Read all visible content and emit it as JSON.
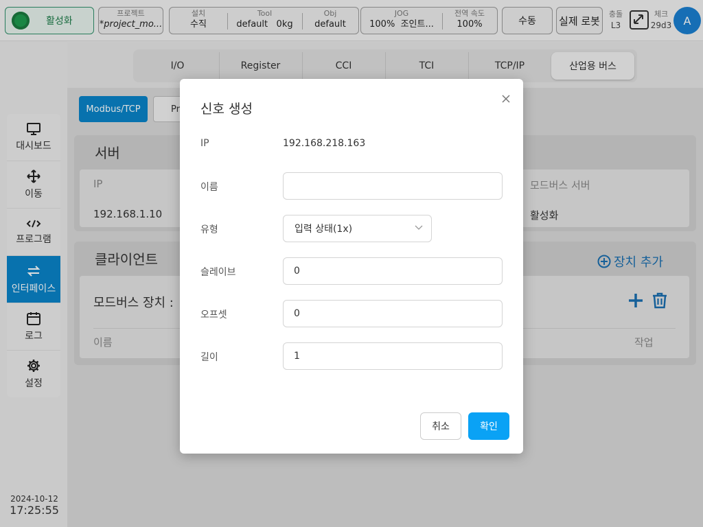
{
  "topbar": {
    "status_label": "활성화",
    "project": {
      "label": "프로젝트",
      "value": "*project_mo..."
    },
    "install": {
      "label": "설치",
      "value": "수직"
    },
    "tool": {
      "label": "Tool",
      "value": "default",
      "weight": "0kg"
    },
    "obj": {
      "label": "Obj",
      "value": "default"
    },
    "jog": {
      "label": "JOG",
      "percent": "100%",
      "mode": "조인트..."
    },
    "global_speed": {
      "label": "전역 속도",
      "value": "100%"
    },
    "mode_button": "수동",
    "robot_button": "실제 로봇",
    "collision": {
      "label": "충돌",
      "value": "L3"
    },
    "check": {
      "label": "체크",
      "value": "29d3"
    },
    "avatar_letter": "A"
  },
  "sidebar": {
    "items": [
      {
        "label": "대시보드",
        "icon": "monitor-icon"
      },
      {
        "label": "이동",
        "icon": "move-icon"
      },
      {
        "label": "프로그램",
        "icon": "code-icon"
      },
      {
        "label": "인터페이스",
        "icon": "swap-icon",
        "active": true
      },
      {
        "label": "로그",
        "icon": "calendar-icon"
      },
      {
        "label": "설정",
        "icon": "gear-icon"
      }
    ],
    "date": "2024-10-12",
    "time": "17:25:55"
  },
  "tabs": [
    "I/O",
    "Register",
    "CCI",
    "TCI",
    "TCP/IP",
    "산업용 버스"
  ],
  "protocol": {
    "active": "Modbus/TCP",
    "other": "Pr"
  },
  "server": {
    "title": "서버",
    "ip_label": "IP",
    "ip_value": "192.168.1.10",
    "modbus_label": "모드버스 서버",
    "modbus_value": "활성화"
  },
  "client": {
    "title": "클라이언트",
    "add_device": "장치 추가",
    "device_title": "모드버스 장치 :",
    "col_name": "이름",
    "col_action": "작업"
  },
  "dialog": {
    "title": "신호 생성",
    "ip_label": "IP",
    "ip_value": "192.168.218.163",
    "name_label": "이름",
    "name_value": "",
    "type_label": "유형",
    "type_value": "입력 상태(1x)",
    "slave_label": "슬레이브",
    "slave_value": "0",
    "offset_label": "오프셋",
    "offset_value": "0",
    "length_label": "길이",
    "length_value": "1",
    "cancel": "취소",
    "confirm": "확인"
  },
  "colors": {
    "accent": "#0a84c8",
    "confirm": "#0aa2f5",
    "status_green": "#1e9a4f"
  }
}
